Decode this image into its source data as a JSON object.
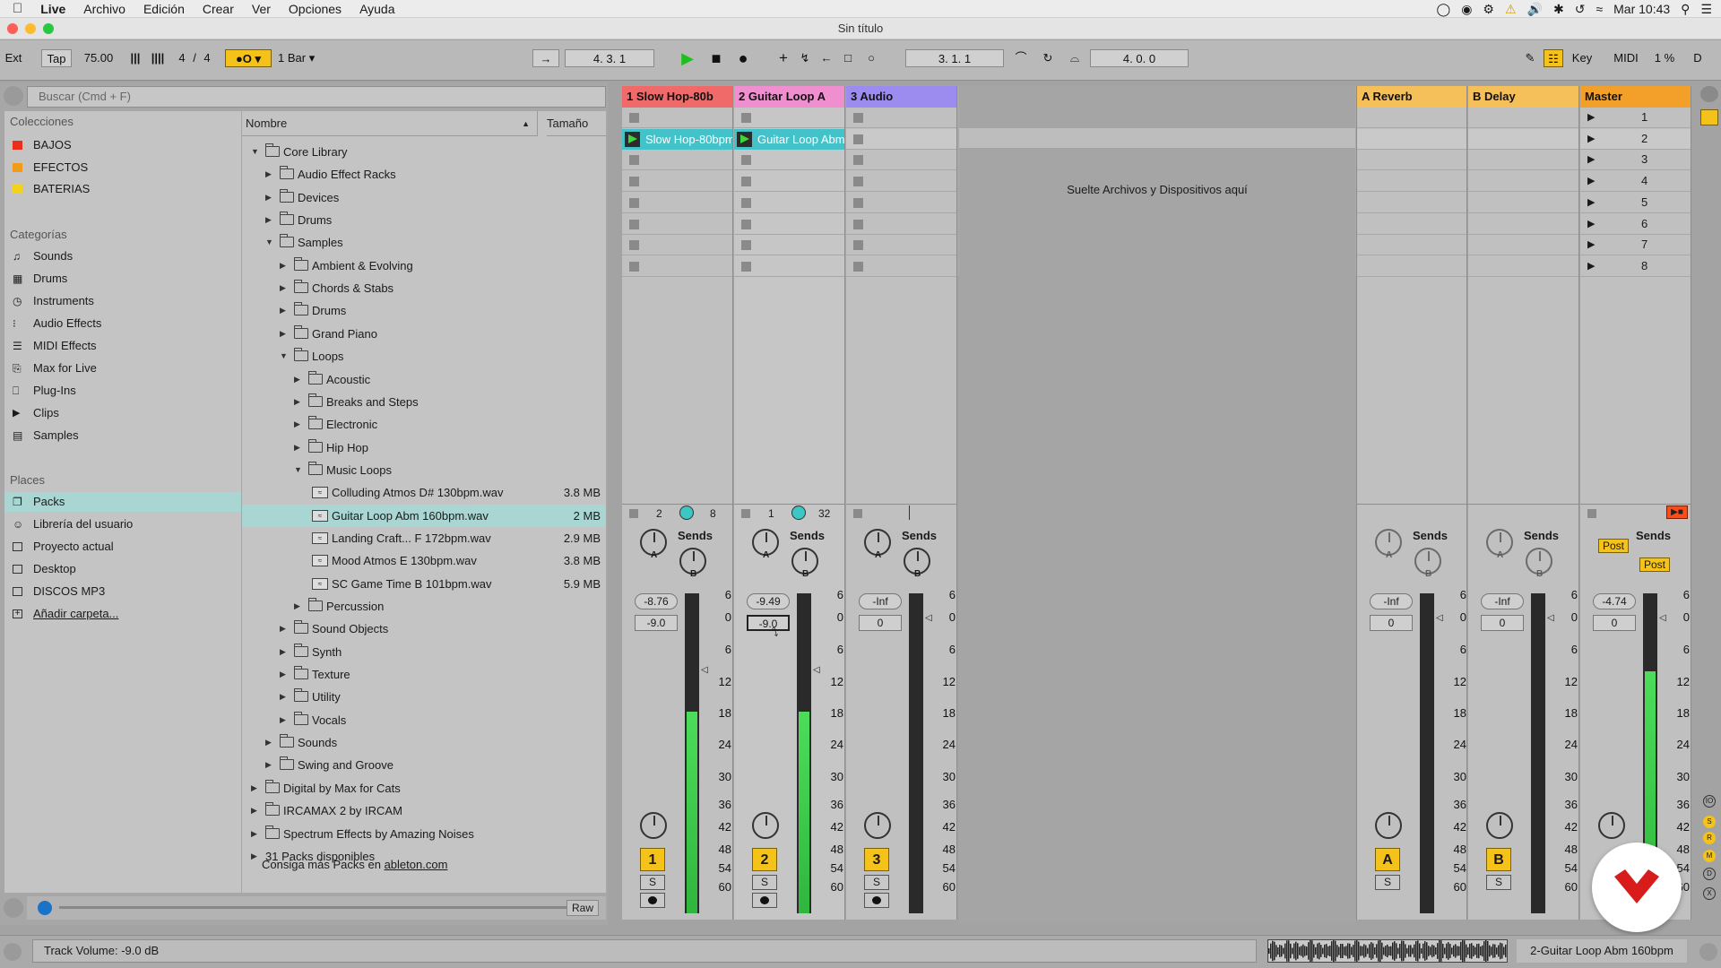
{
  "menubar": {
    "apple": "",
    "app": "Live",
    "items": [
      "Archivo",
      "Edición",
      "Crear",
      "Ver",
      "Opciones",
      "Ayuda"
    ],
    "clock": "Mar 10:43"
  },
  "window": {
    "title": "Sin título"
  },
  "control": {
    "ext": "Ext",
    "tap": "Tap",
    "tempo": "75.00",
    "signature_num": "4",
    "signature_den": "4",
    "quantize": "1 Bar",
    "arrangement_position": "4.   3.   1",
    "loop_start": "3.   1.   1",
    "loop_length": "4.   0.   0",
    "key": "Key",
    "midi": "MIDI",
    "cpu": "1 %",
    "d": "D"
  },
  "browser": {
    "search_placeholder": "Buscar (Cmd + F)",
    "collections_header": "Colecciones",
    "collections": [
      {
        "label": "BAJOS",
        "color": "#e8301c"
      },
      {
        "label": "EFECTOS",
        "color": "#f29b1b"
      },
      {
        "label": "BATERIAS",
        "color": "#f4d21c"
      }
    ],
    "categories_header": "Categorías",
    "categories": [
      "Sounds",
      "Drums",
      "Instruments",
      "Audio Effects",
      "MIDI Effects",
      "Max for Live",
      "Plug-Ins",
      "Clips",
      "Samples"
    ],
    "places_header": "Places",
    "places": [
      "Packs",
      "Librería del usuario",
      "Proyecto actual",
      "Desktop",
      "DISCOS MP3",
      "Añadir carpeta..."
    ],
    "col_name": "Nombre",
    "col_size": "Tamaño",
    "tree": [
      {
        "label": "Core Library",
        "level": 0,
        "open": true,
        "type": "pack"
      },
      {
        "label": "Audio Effect Racks",
        "level": 1,
        "type": "folder"
      },
      {
        "label": "Devices",
        "level": 1,
        "type": "folder"
      },
      {
        "label": "Drums",
        "level": 1,
        "type": "folder"
      },
      {
        "label": "Samples",
        "level": 1,
        "open": true,
        "type": "folder"
      },
      {
        "label": "Ambient & Evolving",
        "level": 2,
        "type": "folder"
      },
      {
        "label": "Chords & Stabs",
        "level": 2,
        "type": "folder"
      },
      {
        "label": "Drums",
        "level": 2,
        "type": "folder"
      },
      {
        "label": "Grand Piano",
        "level": 2,
        "type": "folder"
      },
      {
        "label": "Loops",
        "level": 2,
        "open": true,
        "type": "folder"
      },
      {
        "label": "Acoustic",
        "level": 3,
        "type": "folder"
      },
      {
        "label": "Breaks and Steps",
        "level": 3,
        "type": "folder"
      },
      {
        "label": "Electronic",
        "level": 3,
        "type": "folder"
      },
      {
        "label": "Hip Hop",
        "level": 3,
        "type": "folder"
      },
      {
        "label": "Music Loops",
        "level": 3,
        "open": true,
        "type": "folder"
      },
      {
        "label": "Colluding Atmos D# 130bpm.wav",
        "level": 4,
        "type": "wav",
        "size": "3.8 MB"
      },
      {
        "label": "Guitar Loop Abm 160bpm.wav",
        "level": 4,
        "type": "wav",
        "size": "2 MB",
        "selected": true
      },
      {
        "label": "Landing Craft... F 172bpm.wav",
        "level": 4,
        "type": "wav",
        "size": "2.9 MB"
      },
      {
        "label": "Mood Atmos E 130bpm.wav",
        "level": 4,
        "type": "wav",
        "size": "3.8 MB"
      },
      {
        "label": "SC Game Time B 101bpm.wav",
        "level": 4,
        "type": "wav",
        "size": "5.9 MB"
      },
      {
        "label": "Percussion",
        "level": 3,
        "type": "folder"
      },
      {
        "label": "Sound Objects",
        "level": 2,
        "type": "folder"
      },
      {
        "label": "Synth",
        "level": 2,
        "type": "folder"
      },
      {
        "label": "Texture",
        "level": 2,
        "type": "folder"
      },
      {
        "label": "Utility",
        "level": 2,
        "type": "folder"
      },
      {
        "label": "Vocals",
        "level": 2,
        "type": "folder"
      },
      {
        "label": "Sounds",
        "level": 1,
        "type": "folder"
      },
      {
        "label": "Swing and Groove",
        "level": 1,
        "type": "folder"
      },
      {
        "label": "Digital by Max for Cats",
        "level": 0,
        "type": "pack"
      },
      {
        "label": "IRCAMAX 2 by IRCAM",
        "level": 0,
        "type": "pack"
      },
      {
        "label": "Spectrum Effects by Amazing Noises",
        "level": 0,
        "type": "pack"
      },
      {
        "label": "31 Packs disponibles",
        "level": 0,
        "type": "plain"
      }
    ],
    "more_packs_text": "Consiga más Packs en ",
    "more_packs_link": "ableton.com",
    "raw": "Raw"
  },
  "session": {
    "drop_hint": "Suelte Archivos y Dispositivos aquí",
    "sends": "Sends",
    "post": "Post",
    "tracks": [
      {
        "name": "1 Slow Hop-80b",
        "color": "#f06a6a",
        "clip": "Slow Hop-80bpm",
        "in": "2",
        "out": "8",
        "vol": "-8.76",
        "pan": "-9.0",
        "num": "1"
      },
      {
        "name": "2 Guitar Loop A",
        "color": "#f08fcf",
        "clip": "Guitar Loop Abm",
        "in": "1",
        "out": "32",
        "vol": "-9.49",
        "pan": "-9.0",
        "num": "2"
      },
      {
        "name": "3 Audio",
        "color": "#9d8cf0",
        "clip": "",
        "in": "",
        "out": "",
        "vol": "-Inf",
        "pan": "0",
        "num": "3"
      }
    ],
    "returns": [
      {
        "name": "A Reverb",
        "color": "#f5c05a",
        "vol": "-Inf",
        "pan": "0",
        "num": "A"
      },
      {
        "name": "B Delay",
        "color": "#f5c05a",
        "vol": "-Inf",
        "pan": "0",
        "num": "B"
      }
    ],
    "master": {
      "name": "Master",
      "color": "#f2a02a",
      "vol": "-4.74",
      "pan": "0",
      "scenes": [
        "1",
        "2",
        "3",
        "4",
        "5",
        "6",
        "7",
        "8"
      ]
    },
    "scale": [
      "6",
      "0",
      "6",
      "12",
      "18",
      "24",
      "30",
      "36",
      "42",
      "48",
      "54",
      "60"
    ],
    "solo": "S"
  },
  "status": {
    "message": "Track Volume: -9.0 dB",
    "clip_name": "2-Guitar Loop Abm 160bpm"
  }
}
